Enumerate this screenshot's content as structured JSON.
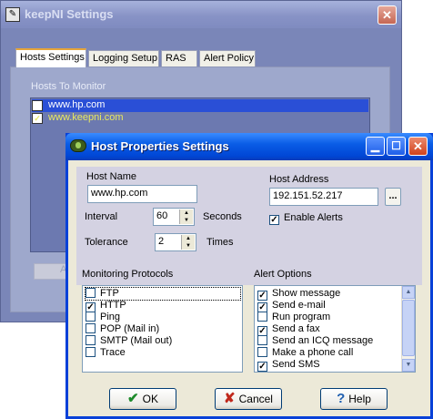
{
  "main_window": {
    "title": "keepNI Settings",
    "app_icon": "settings-window-icon",
    "tabs": [
      "Hosts Settings",
      "Logging Setup",
      "RAS",
      "Alert Policy"
    ],
    "hosts_label": "Hosts To Monitor",
    "hosts": [
      {
        "name": "www.hp.com",
        "checked": true
      },
      {
        "name": "www.keepni.com",
        "checked": true
      }
    ],
    "partial_button_text": "A"
  },
  "dialog": {
    "title": "Host Properties Settings",
    "host_name_label": "Host Name",
    "host_name_value": "www.hp.com",
    "host_address_label": "Host Address",
    "host_address_value": "192.151.52.217",
    "browse_label": "...",
    "interval_label": "Interval",
    "interval_value": "60",
    "interval_unit": "Seconds",
    "tolerance_label": "Tolerance",
    "tolerance_value": "2",
    "tolerance_unit": "Times",
    "enable_alerts_label": "Enable Alerts",
    "enable_alerts_checked": true,
    "protocols_label": "Monitoring Protocols",
    "protocols": [
      {
        "label": "FTP",
        "checked": false
      },
      {
        "label": "HTTP",
        "checked": true
      },
      {
        "label": "Ping",
        "checked": false
      },
      {
        "label": "POP (Mail in)",
        "checked": false
      },
      {
        "label": "SMTP (Mail out)",
        "checked": false
      },
      {
        "label": "Trace",
        "checked": false
      }
    ],
    "alerts_label": "Alert Options",
    "alerts": [
      {
        "label": "Show message",
        "checked": true
      },
      {
        "label": "Send e-mail",
        "checked": true
      },
      {
        "label": "Run program",
        "checked": false
      },
      {
        "label": "Send a fax",
        "checked": true
      },
      {
        "label": "Send an ICQ message",
        "checked": false
      },
      {
        "label": "Make a phone call",
        "checked": false
      },
      {
        "label": "Send SMS",
        "checked": true
      }
    ],
    "ok_label": "OK",
    "cancel_label": "Cancel",
    "help_label": "Help"
  },
  "colors": {
    "ok_icon": "#1c8a2a",
    "cancel_icon": "#c0281c",
    "help_icon": "#1f5fb0",
    "xp_blue": "#0046d5"
  }
}
